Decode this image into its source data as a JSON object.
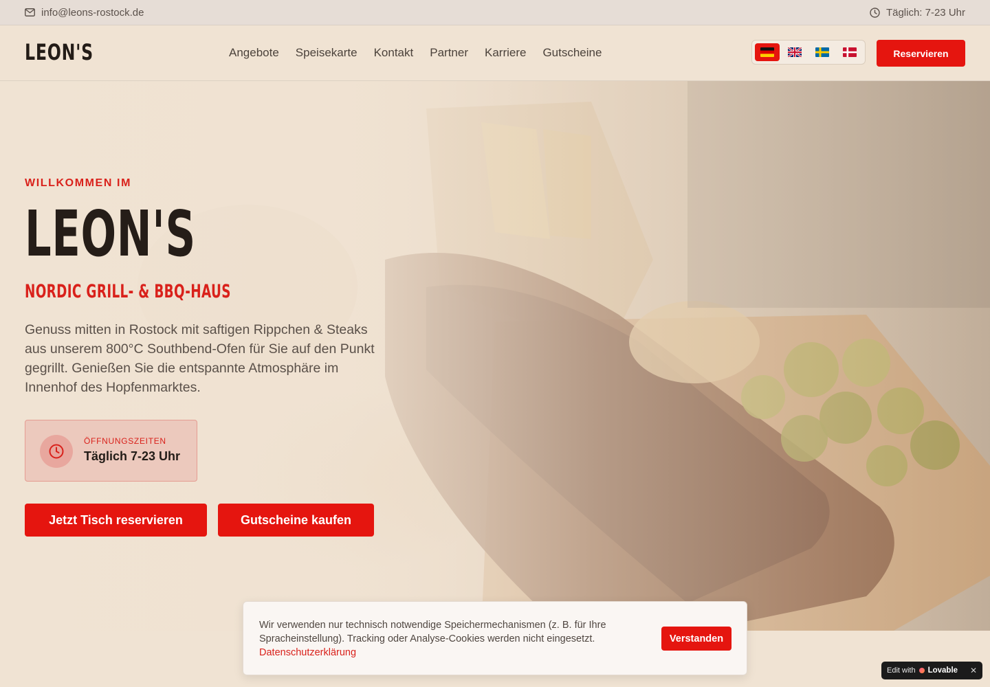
{
  "topbar": {
    "email": "info@leons-rostock.de",
    "hours": "Täglich: 7-23 Uhr",
    "email_icon": "mail-icon",
    "hours_icon": "clock-icon"
  },
  "header": {
    "logo": "LEON'S",
    "nav": [
      "Angebote",
      "Speisekarte",
      "Kontakt",
      "Partner",
      "Karriere",
      "Gutscheine"
    ],
    "languages": [
      {
        "code": "de",
        "icon": "flag-germany-icon",
        "active": true
      },
      {
        "code": "en",
        "icon": "flag-uk-icon",
        "active": false
      },
      {
        "code": "sv",
        "icon": "flag-sweden-icon",
        "active": false
      },
      {
        "code": "da",
        "icon": "flag-denmark-icon",
        "active": false
      }
    ],
    "reserve_label": "Reservieren"
  },
  "hero": {
    "kicker": "WILLKOMMEN IM",
    "title": "LEON'S",
    "subtitle": "NORDIC GRILL- & BBQ-HAUS",
    "description": "Genuss mitten in Rostock mit saftigen Rippchen & Steaks aus unserem 800°C Southbend-Ofen für Sie auf den Punkt gegrillt. Genießen Sie die entspannte Atmosphäre im Innenhof des Hopfenmarktes.",
    "hours_label": "ÖFFNUNGSZEITEN",
    "hours_value": "Täglich 7-23 Uhr",
    "cta_primary": "Jetzt Tisch reservieren",
    "cta_secondary": "Gutscheine kaufen"
  },
  "cookie": {
    "text": "Wir verwenden nur technisch notwendige Speichermechanismen (z. B. für Ihre Spracheinstellung). Tracking oder Analyse-Cookies werden nicht eingesetzt.",
    "link": "Datenschutzerklärung",
    "button": "Verstanden"
  },
  "badge": {
    "prefix": "Edit with",
    "brand": "Lovable",
    "close": "✕"
  },
  "colors": {
    "accent": "#e5150f",
    "background": "#f0e3d3",
    "text": "#231c17"
  }
}
